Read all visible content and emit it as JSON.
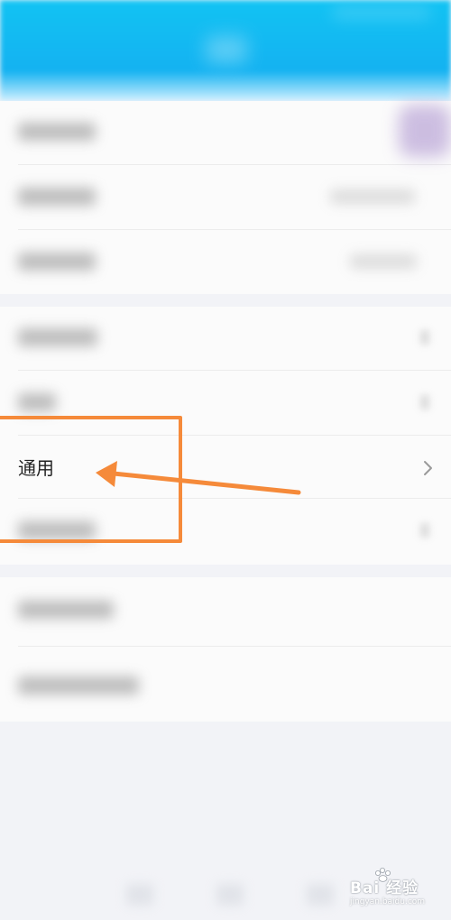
{
  "settings_list": {
    "highlighted_item": {
      "label": "通用"
    }
  },
  "annotation": {
    "box_color": "#f58a3a",
    "arrow_color": "#f58a3a"
  },
  "watermark": {
    "text": "Bai 经验",
    "url": "jingyan.baidu.com"
  },
  "colors": {
    "header_top": "#12c3f3",
    "header_bottom": "#14b2f1",
    "background": "#f2f3f7",
    "row_background": "#fbfbfb"
  },
  "icons": [
    "chevron-right-icon",
    "paw-logo-icon"
  ]
}
